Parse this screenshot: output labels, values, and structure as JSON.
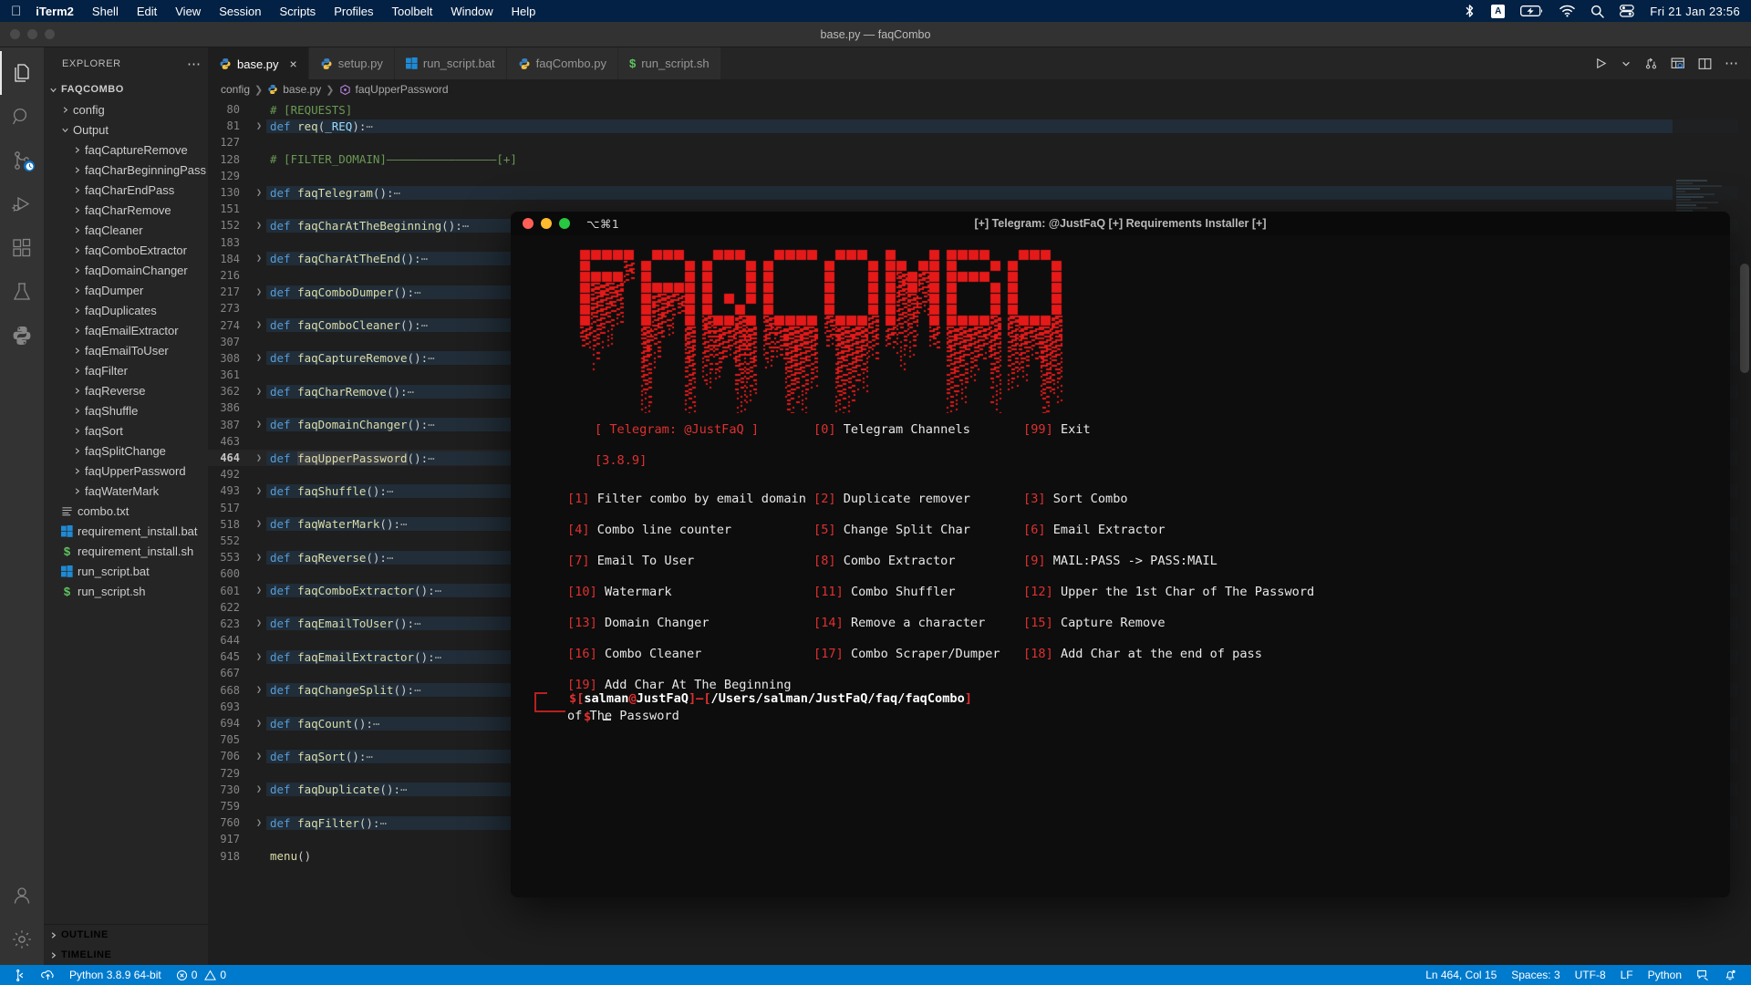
{
  "macbar": {
    "apple_icon": "apple-icon",
    "items": [
      {
        "label": "iTerm2",
        "bold": true
      },
      {
        "label": "Shell",
        "bold": false
      },
      {
        "label": "Edit",
        "bold": false
      },
      {
        "label": "View",
        "bold": false
      },
      {
        "label": "Session",
        "bold": false
      },
      {
        "label": "Scripts",
        "bold": false
      },
      {
        "label": "Profiles",
        "bold": false
      },
      {
        "label": "Toolbelt",
        "bold": false
      },
      {
        "label": "Window",
        "bold": false
      },
      {
        "label": "Help",
        "bold": false
      }
    ],
    "status_icons": [
      "bluetooth-icon",
      "input-source-icon",
      "battery-charging-icon",
      "wifi-icon",
      "search-icon",
      "control-center-icon"
    ],
    "input_source_letter": "A",
    "clock": "Fri 21 Jan  23:56"
  },
  "window": {
    "title": "base.py — faqCombo"
  },
  "activitybar": {
    "items": [
      {
        "name": "explorer",
        "icon": "files-icon",
        "active": true
      },
      {
        "name": "search",
        "icon": "search-icon",
        "active": false
      },
      {
        "name": "source-control",
        "icon": "source-control-icon",
        "active": false,
        "badge": "clock"
      },
      {
        "name": "run-debug",
        "icon": "run-debug-icon",
        "active": false
      },
      {
        "name": "extensions",
        "icon": "extensions-icon",
        "active": false
      },
      {
        "name": "testing",
        "icon": "beaker-icon",
        "active": false
      },
      {
        "name": "python",
        "icon": "python-icon",
        "active": false
      }
    ],
    "bottom": [
      {
        "name": "accounts",
        "icon": "account-icon"
      },
      {
        "name": "settings",
        "icon": "gear-icon"
      }
    ]
  },
  "sidebar": {
    "header": "EXPLORER",
    "more_actions": "⋯",
    "root": "FAQCOMBO",
    "tree": [
      {
        "label": "config",
        "depth": 1,
        "type": "folder",
        "expanded": false
      },
      {
        "label": "Output",
        "depth": 1,
        "type": "folder",
        "expanded": true
      },
      {
        "label": "faqCaptureRemove",
        "depth": 2,
        "type": "folder",
        "expanded": false
      },
      {
        "label": "faqCharBeginningPass",
        "depth": 2,
        "type": "folder",
        "expanded": false
      },
      {
        "label": "faqCharEndPass",
        "depth": 2,
        "type": "folder",
        "expanded": false
      },
      {
        "label": "faqCharRemove",
        "depth": 2,
        "type": "folder",
        "expanded": false
      },
      {
        "label": "faqCleaner",
        "depth": 2,
        "type": "folder",
        "expanded": false
      },
      {
        "label": "faqComboExtractor",
        "depth": 2,
        "type": "folder",
        "expanded": false
      },
      {
        "label": "faqDomainChanger",
        "depth": 2,
        "type": "folder",
        "expanded": false
      },
      {
        "label": "faqDumper",
        "depth": 2,
        "type": "folder",
        "expanded": false
      },
      {
        "label": "faqDuplicates",
        "depth": 2,
        "type": "folder",
        "expanded": false
      },
      {
        "label": "faqEmailExtractor",
        "depth": 2,
        "type": "folder",
        "expanded": false
      },
      {
        "label": "faqEmailToUser",
        "depth": 2,
        "type": "folder",
        "expanded": false
      },
      {
        "label": "faqFilter",
        "depth": 2,
        "type": "folder",
        "expanded": false
      },
      {
        "label": "faqReverse",
        "depth": 2,
        "type": "folder",
        "expanded": false
      },
      {
        "label": "faqShuffle",
        "depth": 2,
        "type": "folder",
        "expanded": false
      },
      {
        "label": "faqSort",
        "depth": 2,
        "type": "folder",
        "expanded": false
      },
      {
        "label": "faqSplitChange",
        "depth": 2,
        "type": "folder",
        "expanded": false
      },
      {
        "label": "faqUpperPassword",
        "depth": 2,
        "type": "folder",
        "expanded": false
      },
      {
        "label": "faqWaterMark",
        "depth": 2,
        "type": "folder",
        "expanded": false
      },
      {
        "label": "combo.txt",
        "depth": 1,
        "type": "text"
      },
      {
        "label": "requirement_install.bat",
        "depth": 1,
        "type": "bat"
      },
      {
        "label": "requirement_install.sh",
        "depth": 1,
        "type": "sh"
      },
      {
        "label": "run_script.bat",
        "depth": 1,
        "type": "bat"
      },
      {
        "label": "run_script.sh",
        "depth": 1,
        "type": "sh"
      }
    ],
    "sections": [
      {
        "label": "OUTLINE"
      },
      {
        "label": "TIMELINE"
      }
    ]
  },
  "tabs": [
    {
      "label": "base.py",
      "icon": "python-icon",
      "active": true,
      "close": "×"
    },
    {
      "label": "setup.py",
      "icon": "python-icon",
      "active": false
    },
    {
      "label": "run_script.bat",
      "icon": "windows-icon",
      "active": false
    },
    {
      "label": "faqCombo.py",
      "icon": "python-icon",
      "active": false
    },
    {
      "label": "run_script.sh",
      "icon": "shell-icon",
      "active": false
    }
  ],
  "editor_actions": [
    "run-icon",
    "chevron-down-icon",
    "source-control-icon",
    "split-preview-icon",
    "split-editor-icon",
    "more-actions-icon"
  ],
  "breadcrumb": [
    {
      "label": "config",
      "icon": null
    },
    {
      "label": "base.py",
      "icon": "python-icon"
    },
    {
      "label": "faqUpperPassword",
      "icon": "symbol-method-icon"
    }
  ],
  "code": {
    "lines": [
      {
        "num": "80",
        "text": "# [REQUESTS]",
        "kind": "comment",
        "clipped": true
      },
      {
        "num": "81",
        "text": "def req(_REQ):",
        "kind": "def",
        "name": "req",
        "args": "_REQ",
        "folded": true
      },
      {
        "num": "127",
        "text": "",
        "kind": "blank"
      },
      {
        "num": "128",
        "text": "# [FILTER_DOMAIN]————————————————[+]",
        "kind": "comment"
      },
      {
        "num": "129",
        "text": "",
        "kind": "blank"
      },
      {
        "num": "130",
        "text": "def faqTelegram():",
        "kind": "def",
        "name": "faqTelegram",
        "args": "",
        "folded": true
      },
      {
        "num": "151",
        "text": "",
        "kind": "blank"
      },
      {
        "num": "152",
        "text": "def faqCharAtTheBeginning():",
        "kind": "def",
        "name": "faqCharAtTheBeginning",
        "args": "",
        "folded": true
      },
      {
        "num": "183",
        "text": "",
        "kind": "blank"
      },
      {
        "num": "184",
        "text": "def faqCharAtTheEnd():",
        "kind": "def",
        "name": "faqCharAtTheEnd",
        "args": "",
        "folded": true
      },
      {
        "num": "216",
        "text": "",
        "kind": "blank"
      },
      {
        "num": "217",
        "text": "def faqComboDumper():",
        "kind": "def",
        "name": "faqComboDumper",
        "args": "",
        "folded": true
      },
      {
        "num": "273",
        "text": "",
        "kind": "blank"
      },
      {
        "num": "274",
        "text": "def faqComboCleaner():",
        "kind": "def",
        "name": "faqComboCleaner",
        "args": "",
        "folded": true
      },
      {
        "num": "307",
        "text": "",
        "kind": "blank"
      },
      {
        "num": "308",
        "text": "def faqCaptureRemove():",
        "kind": "def",
        "name": "faqCaptureRemove",
        "args": "",
        "folded": true
      },
      {
        "num": "361",
        "text": "",
        "kind": "blank"
      },
      {
        "num": "362",
        "text": "def faqCharRemove():",
        "kind": "def",
        "name": "faqCharRemove",
        "args": "",
        "folded": true
      },
      {
        "num": "386",
        "text": "",
        "kind": "blank"
      },
      {
        "num": "387",
        "text": "def faqDomainChanger():",
        "kind": "def",
        "name": "faqDomainChanger",
        "args": "",
        "folded": true
      },
      {
        "num": "463",
        "text": "",
        "kind": "blank"
      },
      {
        "num": "464",
        "text": "def faqUpperPassword():",
        "kind": "def",
        "name": "faqUpperPassword",
        "args": "",
        "folded": true,
        "current": true,
        "selected": true
      },
      {
        "num": "492",
        "text": "",
        "kind": "blank"
      },
      {
        "num": "493",
        "text": "def faqShuffle():",
        "kind": "def",
        "name": "faqShuffle",
        "args": "",
        "folded": true
      },
      {
        "num": "517",
        "text": "",
        "kind": "blank"
      },
      {
        "num": "518",
        "text": "def faqWaterMark():",
        "kind": "def",
        "name": "faqWaterMark",
        "args": "",
        "folded": true
      },
      {
        "num": "552",
        "text": "",
        "kind": "blank"
      },
      {
        "num": "553",
        "text": "def faqReverse():",
        "kind": "def",
        "name": "faqReverse",
        "args": "",
        "folded": true
      },
      {
        "num": "600",
        "text": "",
        "kind": "blank"
      },
      {
        "num": "601",
        "text": "def faqComboExtractor():",
        "kind": "def",
        "name": "faqComboExtractor",
        "args": "",
        "folded": true
      },
      {
        "num": "622",
        "text": "",
        "kind": "blank"
      },
      {
        "num": "623",
        "text": "def faqEmailToUser():",
        "kind": "def",
        "name": "faqEmailToUser",
        "args": "",
        "folded": true
      },
      {
        "num": "644",
        "text": "",
        "kind": "blank"
      },
      {
        "num": "645",
        "text": "def faqEmailExtractor():",
        "kind": "def",
        "name": "faqEmailExtractor",
        "args": "",
        "folded": true
      },
      {
        "num": "667",
        "text": "",
        "kind": "blank"
      },
      {
        "num": "668",
        "text": "def faqChangeSplit():",
        "kind": "def",
        "name": "faqChangeSplit",
        "args": "",
        "folded": true
      },
      {
        "num": "693",
        "text": "",
        "kind": "blank"
      },
      {
        "num": "694",
        "text": "def faqCount():",
        "kind": "def",
        "name": "faqCount",
        "args": "",
        "folded": true
      },
      {
        "num": "705",
        "text": "",
        "kind": "blank"
      },
      {
        "num": "706",
        "text": "def faqSort():",
        "kind": "def",
        "name": "faqSort",
        "args": "",
        "folded": true
      },
      {
        "num": "729",
        "text": "",
        "kind": "blank"
      },
      {
        "num": "730",
        "text": "def faqDuplicate():",
        "kind": "def",
        "name": "faqDuplicate",
        "args": "",
        "folded": true
      },
      {
        "num": "759",
        "text": "",
        "kind": "blank"
      },
      {
        "num": "760",
        "text": "def faqFilter():",
        "kind": "def",
        "name": "faqFilter",
        "args": "",
        "folded": true
      },
      {
        "num": "917",
        "text": "",
        "kind": "blank"
      },
      {
        "num": "918",
        "text": "menu()",
        "kind": "call",
        "name": "menu"
      }
    ]
  },
  "terminal": {
    "shortcut": "⌥⌘1",
    "title": "[+] Telegram: @JustFaQ [+] Requirements Installer [+]",
    "logo_text": "FAQCOMBO",
    "logo_color": "#e61919",
    "header": {
      "telegram_prefix": "[ Telegram: ",
      "telegram_handle": "@JustFaQ",
      "telegram_suffix": " ]",
      "version": "[3.8.9]",
      "channels_key": "0",
      "channels_label": "Telegram Channels",
      "exit_key": "99",
      "exit_label": "Exit"
    },
    "menu": [
      [
        {
          "key": "1",
          "label": "Filter combo by email domain"
        },
        {
          "key": "2",
          "label": "Duplicate remover"
        },
        {
          "key": "3",
          "label": "Sort Combo"
        }
      ],
      [
        {
          "key": "4",
          "label": "Combo line counter"
        },
        {
          "key": "5",
          "label": "Change Split Char"
        },
        {
          "key": "6",
          "label": "Email Extractor"
        }
      ],
      [
        {
          "key": "7",
          "label": "Email To User"
        },
        {
          "key": "8",
          "label": "Combo Extractor"
        },
        {
          "key": "9",
          "label": "MAIL:PASS -> PASS:MAIL"
        }
      ],
      [
        {
          "key": "10",
          "label": "Watermark"
        },
        {
          "key": "11",
          "label": "Combo Shuffler"
        },
        {
          "key": "12",
          "label": "Upper the 1st Char of The Password"
        }
      ],
      [
        {
          "key": "13",
          "label": "Domain Changer"
        },
        {
          "key": "14",
          "label": "Remove a character"
        },
        {
          "key": "15",
          "label": "Capture Remove"
        }
      ],
      [
        {
          "key": "16",
          "label": "Combo Cleaner"
        },
        {
          "key": "17",
          "label": "Combo Scraper/Dumper"
        },
        {
          "key": "18",
          "label": "Add Char at the end of pass"
        }
      ],
      [
        {
          "key": "19",
          "label": "Add Char At The Beginning of The Password"
        }
      ]
    ],
    "prompt": {
      "dollar": "$",
      "user": "salman",
      "at": "@",
      "host": "JustFaQ",
      "path": "/Users/salman/JustFaQ/faq/faqCombo",
      "second_line": "$",
      "cursor": "_"
    }
  },
  "statusbar": {
    "left": [
      {
        "name": "remote-icon",
        "label": ""
      },
      {
        "name": "source-control-branch-icon",
        "label": ""
      },
      {
        "name": "sync-icon",
        "label": ""
      },
      {
        "name": "python-version",
        "label": "Python 3.8.9 64-bit"
      },
      {
        "name": "errors",
        "label": "0",
        "icon": "error-icon"
      },
      {
        "name": "warnings",
        "label": "0",
        "icon": "warning-icon"
      }
    ],
    "right": [
      {
        "name": "cursor-position",
        "label": "Ln 464, Col 15"
      },
      {
        "name": "indentation",
        "label": "Spaces: 3"
      },
      {
        "name": "encoding",
        "label": "UTF-8"
      },
      {
        "name": "eol",
        "label": "LF"
      },
      {
        "name": "language-mode",
        "label": "Python"
      },
      {
        "name": "feedback-icon",
        "label": ""
      },
      {
        "name": "notifications-icon",
        "label": ""
      }
    ]
  },
  "colors": {
    "accent": "#007acc",
    "terminal_red": "#e03030",
    "menubar_bg": "#032144"
  }
}
